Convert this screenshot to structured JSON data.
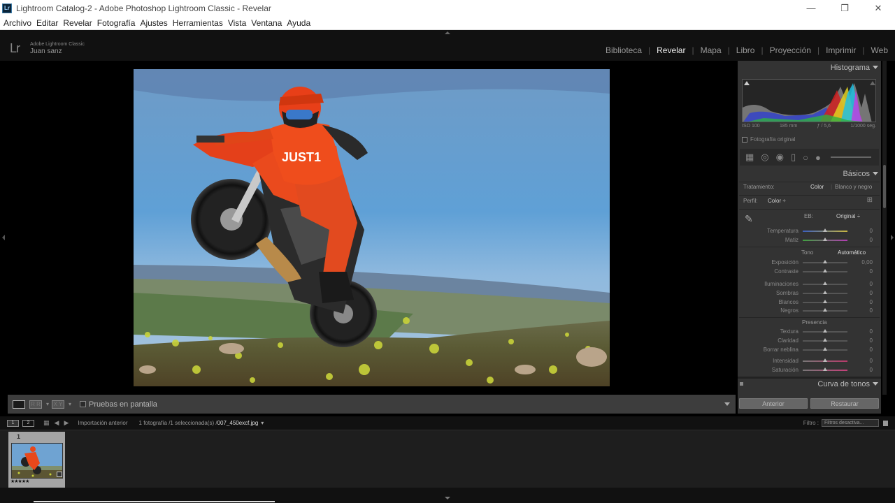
{
  "window": {
    "title": "Lightroom Catalog-2 - Adobe Photoshop Lightroom Classic - Revelar",
    "app_badge": "Lr",
    "minimize": "—",
    "restore": "❐",
    "close": "✕"
  },
  "menu": [
    "Archivo",
    "Editar",
    "Revelar",
    "Fotografía",
    "Ajustes",
    "Herramientas",
    "Vista",
    "Ventana",
    "Ayuda"
  ],
  "identity": {
    "logo": "Lr",
    "product": "Adobe Lightroom Classic",
    "user": "Juan sanz"
  },
  "modules": [
    {
      "label": "Biblioteca",
      "active": false
    },
    {
      "label": "Revelar",
      "active": true
    },
    {
      "label": "Mapa",
      "active": false
    },
    {
      "label": "Libro",
      "active": false
    },
    {
      "label": "Proyección",
      "active": false
    },
    {
      "label": "Imprimir",
      "active": false
    },
    {
      "label": "Web",
      "active": false
    }
  ],
  "toolbar": {
    "view_rr": "R R",
    "view_xy": "X Y",
    "proof_label": "Pruebas en pantalla"
  },
  "histogram": {
    "title": "Histograma",
    "iso": "ISO 100",
    "focal": "185 mm",
    "aperture": "ƒ / 5,6",
    "shutter": "1/1000 seg.",
    "original_label": "Fotografía original"
  },
  "basics": {
    "title": "Básicos",
    "treatment_label": "Tratamiento:",
    "treatment_color": "Color",
    "treatment_bw": "Blanco y negro",
    "profile_label": "Perfil:",
    "profile_value": "Color ÷",
    "wb_label": "EB:",
    "wb_value": "Original ÷",
    "tone_label": "Tono",
    "auto_label": "Automático",
    "presence_label": "Presencia"
  },
  "sliders": [
    {
      "key": "temp",
      "label": "Temperatura",
      "value": "0",
      "pos": 0.5
    },
    {
      "key": "tint",
      "label": "Matiz",
      "value": "0",
      "pos": 0.5
    },
    {
      "key": "exp",
      "label": "Exposición",
      "value": "0,00",
      "pos": 0.5
    },
    {
      "key": "contrast",
      "label": "Contraste",
      "value": "0",
      "pos": 0.5
    },
    {
      "key": "highlights",
      "label": "Iluminaciones",
      "value": "0",
      "pos": 0.5
    },
    {
      "key": "shadows",
      "label": "Sombras",
      "value": "0",
      "pos": 0.5
    },
    {
      "key": "whites",
      "label": "Blancos",
      "value": "0",
      "pos": 0.5
    },
    {
      "key": "blacks",
      "label": "Negros",
      "value": "0",
      "pos": 0.5
    },
    {
      "key": "texture",
      "label": "Textura",
      "value": "0",
      "pos": 0.5
    },
    {
      "key": "clarity",
      "label": "Claridad",
      "value": "0",
      "pos": 0.5
    },
    {
      "key": "dehaze",
      "label": "Borrar neblina",
      "value": "0",
      "pos": 0.5
    },
    {
      "key": "vibrance",
      "label": "Intensidad",
      "value": "0",
      "pos": 0.5
    },
    {
      "key": "saturation",
      "label": "Saturación",
      "value": "0",
      "pos": 0.5
    }
  ],
  "tone_curve": {
    "title": "Curva de tonos"
  },
  "buttons": {
    "previous": "Anterior",
    "reset": "Restaurar"
  },
  "filmbar": {
    "monitor1": "1",
    "monitor2": "2",
    "source": "Importación anterior",
    "count": "1 fotografía /1 seleccionada(s) /",
    "filename": "007_450excf.jpg",
    "filter_label": "Filtro :",
    "filter_value": "Filtros desactiva..."
  },
  "thumbnail": {
    "index": "1",
    "stars": "★★★★★"
  },
  "colors": {
    "panel_bg": "#333333",
    "app_bg": "#000000",
    "sky": "#5b9ad0",
    "jersey": "#e8481c"
  }
}
